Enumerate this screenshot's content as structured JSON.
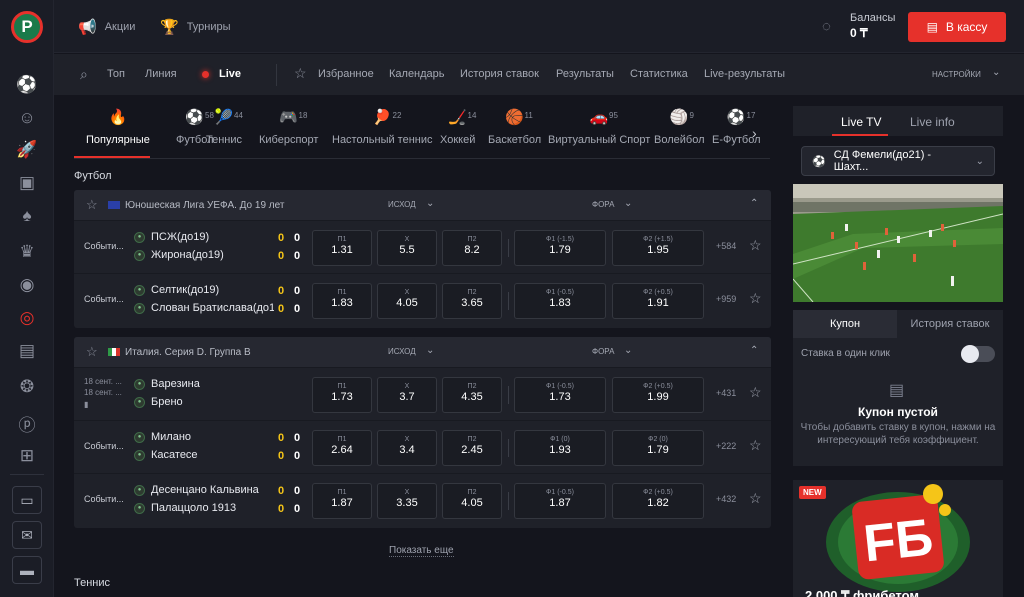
{
  "top": {
    "promos": "Акции",
    "tournaments": "Турниры",
    "balance_label": "Балансы",
    "balance_value": "0 ₸",
    "cash_button": "В кассу"
  },
  "nav": {
    "top": "Топ",
    "line": "Линия",
    "live": "Live",
    "favorites": "Избранное",
    "calendar": "Календарь",
    "history": "История ставок",
    "results": "Результаты",
    "stats": "Статистика",
    "live_results": "Live-результаты",
    "settings": "НАСТРОЙКИ"
  },
  "sports": [
    {
      "label": "Популярные",
      "count": ""
    },
    {
      "label": "Футбол",
      "count": "58"
    },
    {
      "label": "Теннис",
      "count": "44"
    },
    {
      "label": "Киберспорт",
      "count": "18"
    },
    {
      "label": "Настольный теннис",
      "count": "22"
    },
    {
      "label": "Хоккей",
      "count": "14"
    },
    {
      "label": "Баскетбол",
      "count": "11"
    },
    {
      "label": "Виртуальный Спорт",
      "count": "95"
    },
    {
      "label": "Волейбол",
      "count": "9"
    },
    {
      "label": "Е-Футбол",
      "count": "17"
    }
  ],
  "section_football": "Футбол",
  "section_tennis": "Теннис",
  "show_more": "Показать еще",
  "league_headers": {
    "outcome": "ИСХОД",
    "handicap": "ФОРА"
  },
  "leagues": [
    {
      "name": "Юношеская Лига УЕФА. До 19 лет",
      "matches": [
        {
          "event": "Событи...",
          "team1": "ПСЖ(до19)",
          "team2": "Жирона(до19)",
          "s1a": "0",
          "s1b": "0",
          "s2a": "0",
          "s2b": "0",
          "p1": "1.31",
          "x": "5.5",
          "p2": "8.2",
          "f1l": "Ф1 (-1.5)",
          "f1": "1.79",
          "f2l": "Ф2 (+1.5)",
          "f2": "1.95",
          "more": "+584"
        },
        {
          "event": "Событи...",
          "team1": "Селтик(до19)",
          "team2": "Слован Братислава(до19)",
          "s1a": "0",
          "s1b": "0",
          "s2a": "0",
          "s2b": "0",
          "p1": "1.83",
          "x": "4.05",
          "p2": "3.65",
          "f1l": "Ф1 (-0.5)",
          "f1": "1.83",
          "f2l": "Ф2 (+0.5)",
          "f2": "1.91",
          "more": "+959"
        }
      ]
    },
    {
      "name": "Италия. Серия D. Группа B",
      "matches": [
        {
          "event": "",
          "date1": "18 сент. ...",
          "date2": "18 сент. ...",
          "team1": "Варезина",
          "team2": "Брено",
          "s1a": "",
          "s1b": "",
          "s2a": "",
          "s2b": "",
          "p1": "1.73",
          "x": "3.7",
          "p2": "4.35",
          "f1l": "Ф1 (-0.5)",
          "f1": "1.73",
          "f2l": "Ф2 (+0.5)",
          "f2": "1.99",
          "more": "+431"
        },
        {
          "event": "Событи...",
          "team1": "Милано",
          "team2": "Касатесе",
          "s1a": "0",
          "s1b": "0",
          "s2a": "0",
          "s2b": "0",
          "p1": "2.64",
          "x": "3.4",
          "p2": "2.45",
          "f1l": "Ф1 (0)",
          "f1": "1.93",
          "f2l": "Ф2 (0)",
          "f2": "1.79",
          "more": "+222"
        },
        {
          "event": "Событи...",
          "team1": "Десенцано Кальвина",
          "team2": "Палаццоло 1913",
          "s1a": "0",
          "s1b": "0",
          "s2a": "0",
          "s2b": "0",
          "p1": "1.87",
          "x": "3.35",
          "p2": "4.05",
          "f1l": "Ф1 (-0.5)",
          "f1": "1.87",
          "f2l": "Ф2 (+0.5)",
          "f2": "1.82",
          "more": "+432"
        }
      ]
    }
  ],
  "odd_labels": {
    "p1": "П1",
    "x": "Х",
    "p2": "П2"
  },
  "right": {
    "live_tv": "Live TV",
    "live_info": "Live info",
    "channel": "СД Фемели(до21) - Шахт...",
    "coupon_tab": "Купон",
    "history_tab": "История ставок",
    "one_click": "Ставка в один клик",
    "coupon_empty": "Купон пустой",
    "coupon_desc": "Чтобы добавить ставку в купон, нажми на интересующий тебя коэффициент.",
    "new_badge": "NEW",
    "promo_text": "2 000 ₸ фрибетом"
  },
  "colors": {
    "accent": "#e6312b",
    "background": "#14151d",
    "panel": "#1f2129",
    "score": "#f5c518"
  }
}
